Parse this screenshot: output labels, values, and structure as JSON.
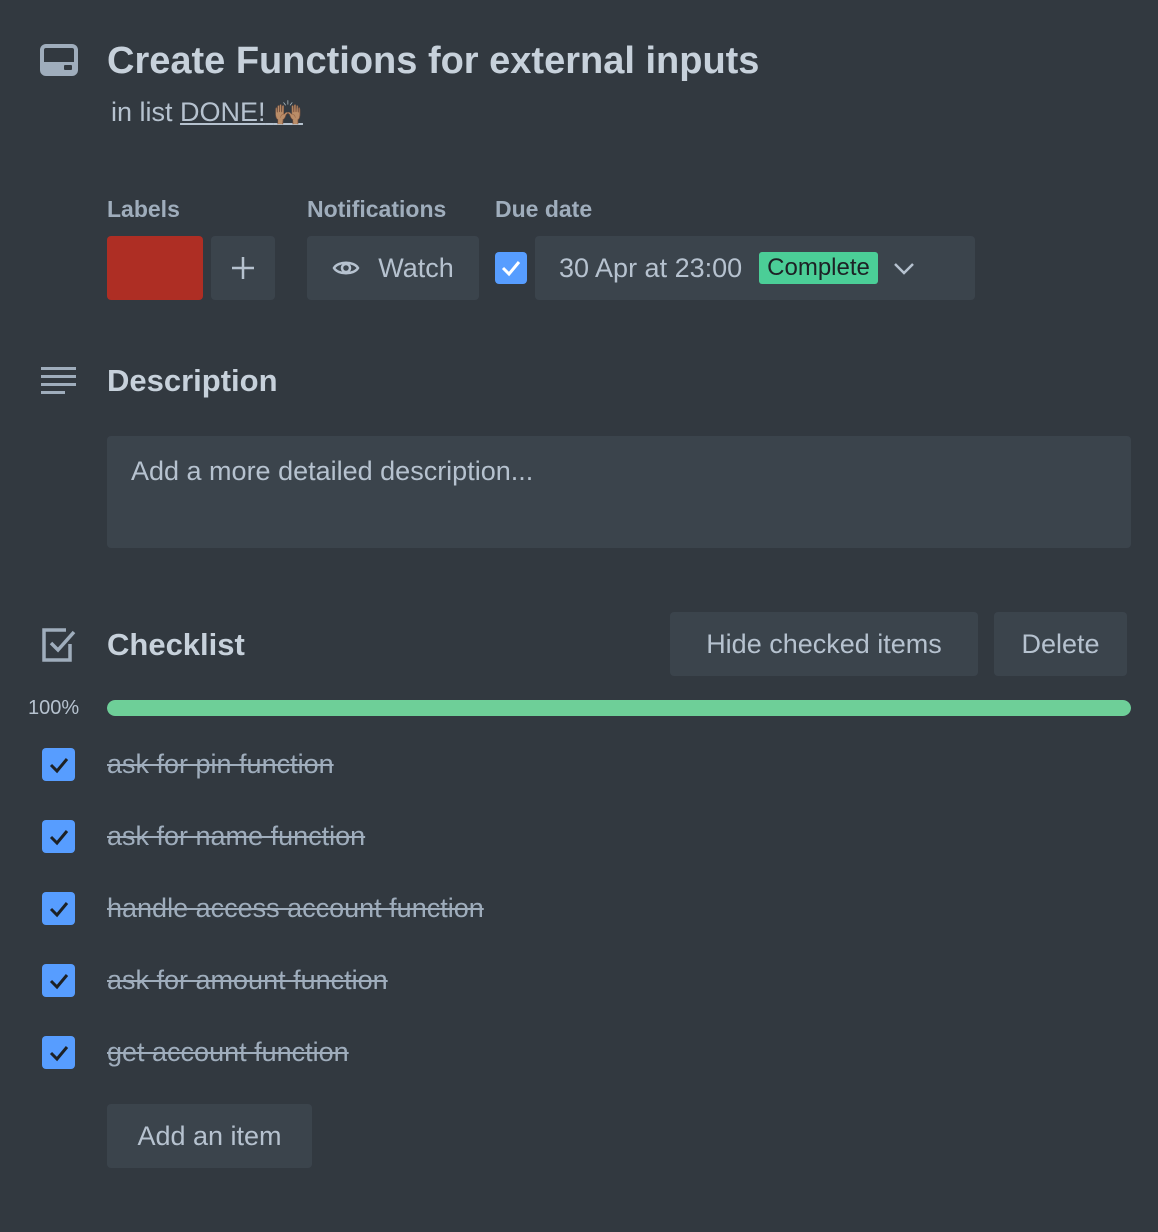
{
  "card": {
    "title": "Create Functions for external inputs",
    "list_prefix": "in list",
    "list_name": "DONE!",
    "list_emoji": "🙌🏽"
  },
  "labels": {
    "heading": "Labels",
    "add_symbol": "+",
    "colors": [
      "#ae2e24"
    ]
  },
  "notifications": {
    "heading": "Notifications",
    "watch_label": "Watch"
  },
  "due_date": {
    "heading": "Due date",
    "checked": true,
    "value": "30 Apr at 23:00",
    "status": "Complete"
  },
  "description": {
    "heading": "Description",
    "placeholder": "Add a more detailed description..."
  },
  "checklist": {
    "heading": "Checklist",
    "hide_label": "Hide checked items",
    "delete_label": "Delete",
    "progress_label": "100%",
    "progress": 1.0,
    "items": [
      {
        "text": "ask for pin function",
        "checked": true
      },
      {
        "text": "ask for name function",
        "checked": true
      },
      {
        "text": "handle access account function",
        "checked": true
      },
      {
        "text": "ask for amount function",
        "checked": true
      },
      {
        "text": "get account function",
        "checked": true
      }
    ],
    "add_item_label": "Add an item"
  },
  "colors": {
    "background": "#323940",
    "button": "#3b444c",
    "accent_blue": "#579dff",
    "complete_green": "#4bce97",
    "progress_green": "#6ecf98",
    "label_red": "#ae2e24"
  }
}
